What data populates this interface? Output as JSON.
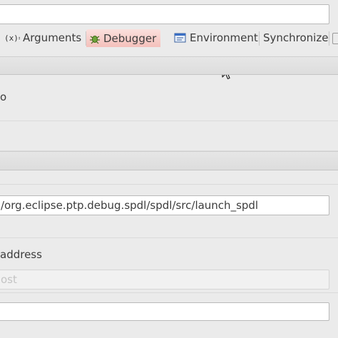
{
  "tabs": [
    {
      "label": "Arguments",
      "icon": "arguments-icon",
      "active": false
    },
    {
      "label": "Debugger",
      "icon": "debugger-icon",
      "active": true
    },
    {
      "label": "Environment",
      "icon": "environment-icon",
      "active": false
    },
    {
      "label": "Synchronize",
      "icon": "",
      "active": false
    }
  ],
  "form": {
    "row1_text": "o",
    "path_value": "/org.eclipse.ptp.debug.spdl/spdl/src/launch_spdl",
    "address_label": "address",
    "host_placeholder": "ost"
  },
  "colors": {
    "active_tab": "#f6c6c2",
    "background": "#ebebeb",
    "field_border": "#b9b9b9"
  }
}
